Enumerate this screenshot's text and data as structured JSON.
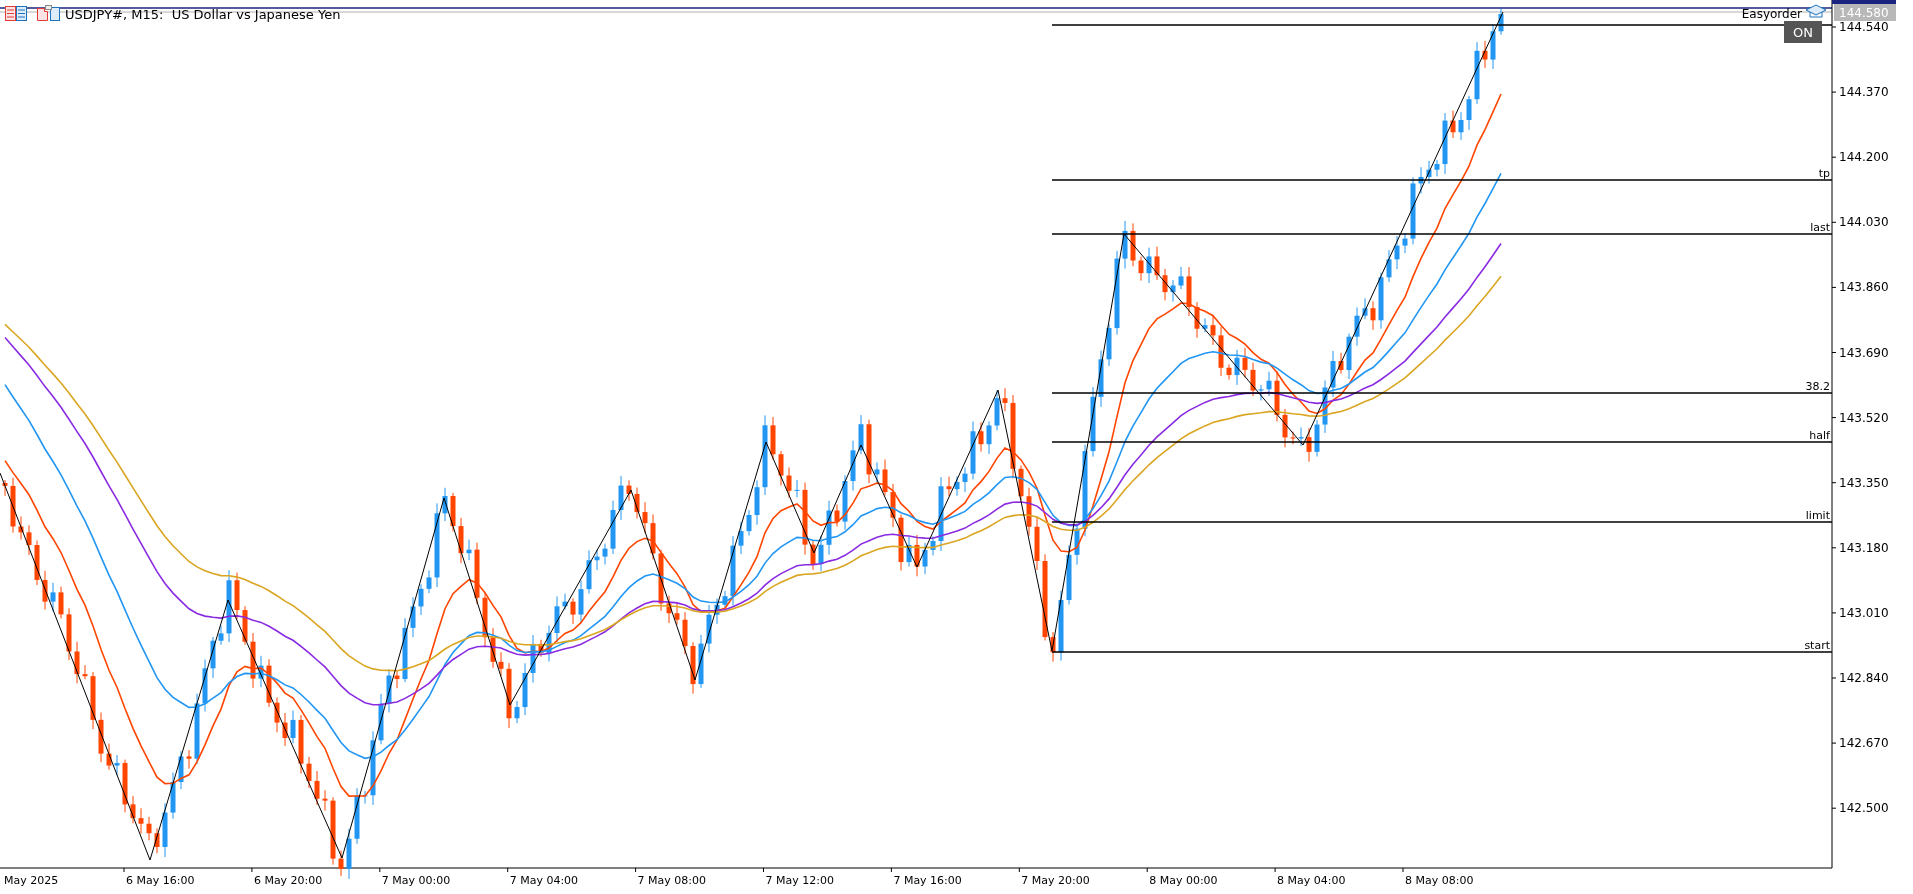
{
  "chart": {
    "title": "USDJPY#, M15:  US Dollar vs Japanese Yen",
    "price_axis": [
      "144.540",
      "144.370",
      "144.200",
      "144.030",
      "143.860",
      "143.690",
      "143.520",
      "143.350",
      "143.180",
      "143.010",
      "142.840",
      "142.670",
      "142.500"
    ],
    "time_axis": [
      "May 2025",
      "6 May 16:00",
      "6 May 20:00",
      "7 May 00:00",
      "7 May 04:00",
      "7 May 08:00",
      "7 May 12:00",
      "7 May 16:00",
      "7 May 20:00",
      "8 May 00:00",
      "8 May 04:00",
      "8 May 08:00"
    ],
    "levels": [
      "tp",
      "last",
      "38.2",
      "half",
      "limit",
      "start"
    ],
    "current_price": "144.580",
    "indicator": {
      "name": "Easyorder",
      "button": "ON"
    }
  }
}
